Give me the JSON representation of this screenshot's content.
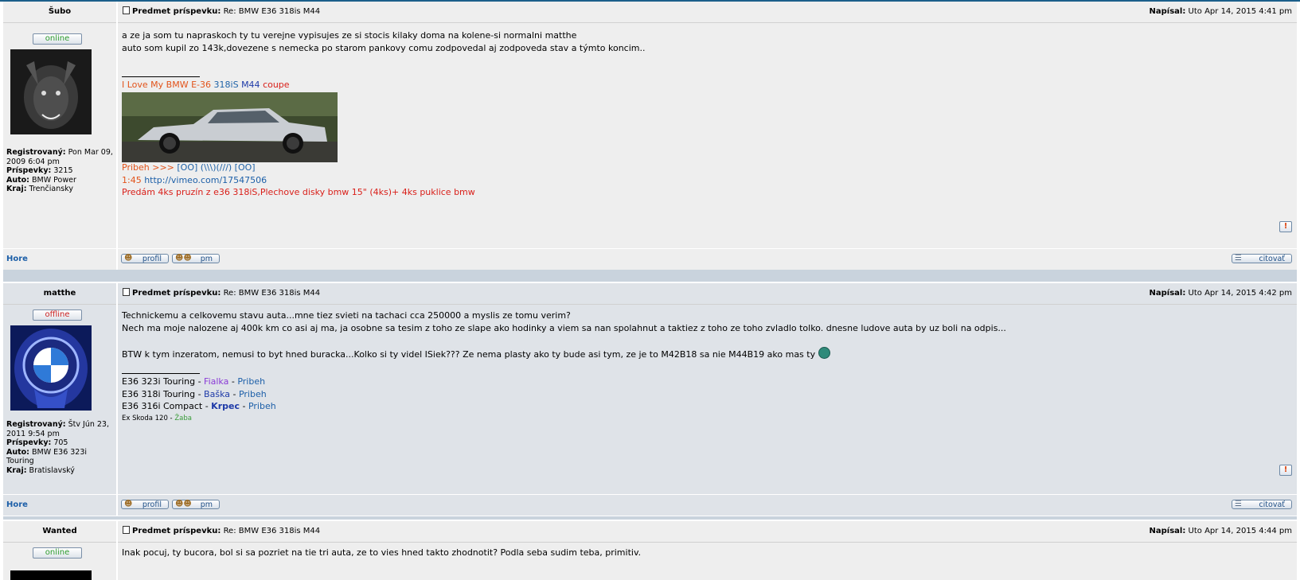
{
  "labels": {
    "subject_label": "Predmet príspevku:",
    "posted_label": "Napísal:",
    "registered_label": "Registrovaný:",
    "posts_label": "Príspevky:",
    "car_label": "Auto:",
    "region_label": "Kraj:",
    "top_link": "Hore",
    "profile_button": "profil",
    "pm_button": "pm",
    "quote_button": "citovať",
    "report_icon": "!"
  },
  "posts": [
    {
      "author": "Šubo",
      "status": "online",
      "subject": "Re: BMW E36 318is M44",
      "posted": "Uto Apr 14, 2015 4:41 pm",
      "registered": "Pon Mar 09, 2009 6:04 pm",
      "posts": "3215",
      "car": "BMW Power",
      "region": "Trenčiansky",
      "message": [
        "a ze ja som tu napraskoch ty tu verejne vypisujes ze si stocis kilaky doma na kolene-si normalni matthe",
        "auto som kupil zo 143k,dovezene s nemecka po starom pankovy comu zodpovedal aj zodpoveda stav a týmto koncim.."
      ],
      "signature": {
        "line1_a": "I Love My BMW E-36",
        "line1_b": "318iS",
        "line1_c": "M44",
        "line1_d": "coupe",
        "line2_a": "Pribeh >>>",
        "line2_b": "[OO] (\\\\\\)(///) [OO]",
        "line3_a": "1:45",
        "line3_b": "http://vimeo.com/17547506",
        "line4": "Predám 4ks pruzín z e36 318iS,Plechove disky bmw 15\" (4ks)+ 4ks puklice bmw"
      }
    },
    {
      "author": "matthe",
      "status": "offline",
      "subject": "Re: BMW E36 318is M44",
      "posted": "Uto Apr 14, 2015 4:42 pm",
      "registered": "Štv Jún 23, 2011 9:54 pm",
      "posts": "705",
      "car": "BMW E36 323i Touring",
      "region": "Bratislavský",
      "message": [
        "Technickemu a celkovemu stavu auta...mne tiez svieti na tachaci cca 250000 a myslis ze tomu verim?",
        "Nech ma moje nalozene aj 400k km co asi aj ma, ja osobne sa tesim z toho ze slape ako hodinky a viem sa nan spolahnut a taktiez z toho ze toho zvladlo tolko. dnesne ludove auta by uz boli na odpis...",
        "BTW k tym inzeratom, nemusi to byt hned buracka...Kolko si ty videl ISiek??? Ze nema plasty ako ty bude asi tym, ze je to M42B18 sa nie M44B19 ako mas ty"
      ],
      "signature": {
        "car1": "E36 323i Touring -",
        "car1_name": "Fialka",
        "car2": "E36 318i Touring -",
        "car2_name": "Baška",
        "car3": "E36 316i Compact -",
        "car3_name": "Krpec",
        "story": "Pribeh",
        "ex": "Ex Skoda 120 -",
        "ex_name": "Žaba"
      }
    },
    {
      "author": "Wanted",
      "status": "online",
      "subject": "Re: BMW E36 318is M44",
      "posted": "Uto Apr 14, 2015 4:44 pm",
      "message": [
        "Inak pocuj, ty bucora, bol si sa pozriet na tie tri auta, ze to vies hned takto zhodnotit? Podla seba sudim teba, primitiv."
      ]
    }
  ]
}
